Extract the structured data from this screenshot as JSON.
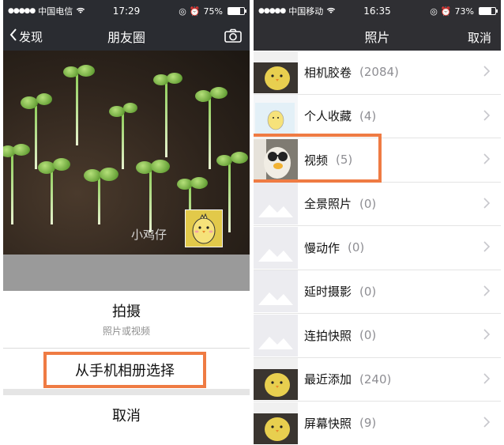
{
  "left_phone": {
    "status": {
      "carrier": "中国电信",
      "time": "17:29",
      "battery": "75%",
      "battery_fraction": 0.75
    },
    "nav": {
      "back_label": "发现",
      "title": "朋友圈",
      "camera_icon": "camera-icon"
    },
    "cover": {
      "nickname": "小鸡仔",
      "avatar_icon": "chick-avatar"
    },
    "action_sheet": {
      "shoot_label": "拍摄",
      "shoot_sub": "照片或视频",
      "album_label": "从手机相册选择",
      "cancel_label": "取消"
    }
  },
  "right_phone": {
    "status": {
      "carrier": "中国移动",
      "time": "16:35",
      "battery": "73%",
      "battery_fraction": 0.73
    },
    "nav": {
      "title": "照片",
      "cancel_label": "取消"
    },
    "albums": [
      {
        "name": "相机胶卷",
        "count": "(2084)",
        "thumb": "chick"
      },
      {
        "name": "个人收藏",
        "count": "(4)",
        "thumb": "chick-light"
      },
      {
        "name": "视频",
        "count": "(5)",
        "thumb": "glasses"
      },
      {
        "name": "全景照片",
        "count": "(0)",
        "thumb": "placeholder"
      },
      {
        "name": "慢动作",
        "count": "(0)",
        "thumb": "placeholder"
      },
      {
        "name": "延时摄影",
        "count": "(0)",
        "thumb": "placeholder"
      },
      {
        "name": "连拍快照",
        "count": "(0)",
        "thumb": "placeholder"
      },
      {
        "name": "最近添加",
        "count": "(240)",
        "thumb": "chick"
      },
      {
        "name": "屏幕快照",
        "count": "(9)",
        "thumb": "chick"
      }
    ]
  },
  "colors": {
    "highlight": "#ef7b43",
    "nav_bg": "#2a2c31",
    "battery": "#ffffff"
  }
}
